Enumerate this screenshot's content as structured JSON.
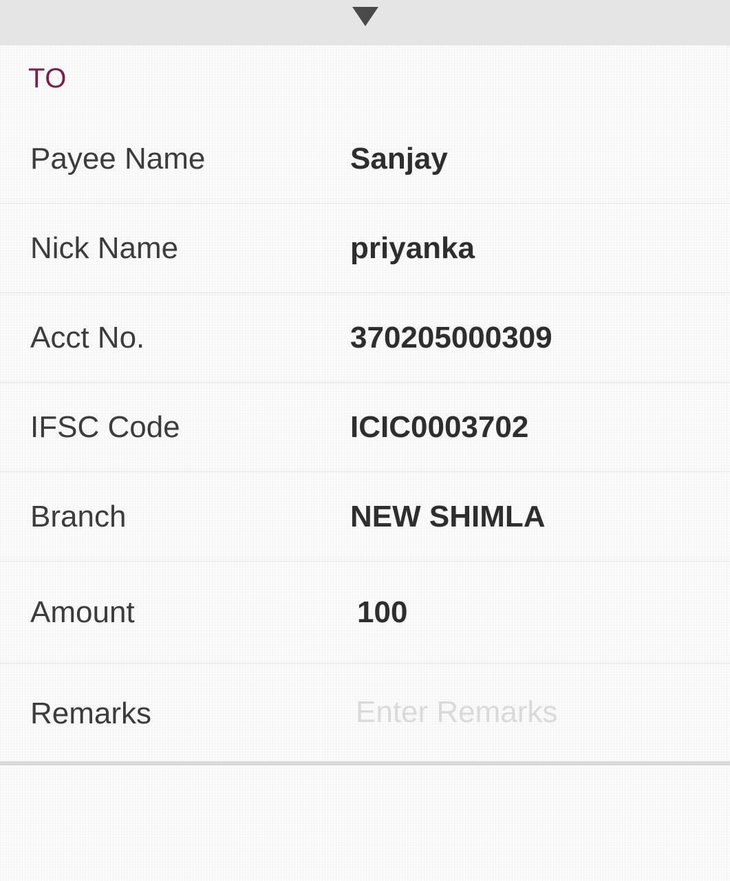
{
  "header": {
    "toggle_icon": "triangle-down-icon"
  },
  "section": {
    "title": "TO"
  },
  "fields": {
    "payee_name": {
      "label": "Payee Name",
      "value": "Sanjay"
    },
    "nick_name": {
      "label": "Nick Name",
      "value": "priyanka"
    },
    "acct_no": {
      "label": "Acct No.",
      "value": "370205000309"
    },
    "ifsc_code": {
      "label": "IFSC Code",
      "value": "ICIC0003702"
    },
    "branch": {
      "label": "Branch",
      "value": "NEW SHIMLA"
    },
    "amount": {
      "label": "Amount",
      "value": "100"
    },
    "remarks": {
      "label": "Remarks",
      "value": "",
      "placeholder": "Enter Remarks"
    }
  },
  "colors": {
    "title": "#7a1e4d",
    "label": "#3c3c3c",
    "value": "#2e2e2e",
    "placeholder": "#dadada",
    "top_bar": "#e5e5e5"
  }
}
